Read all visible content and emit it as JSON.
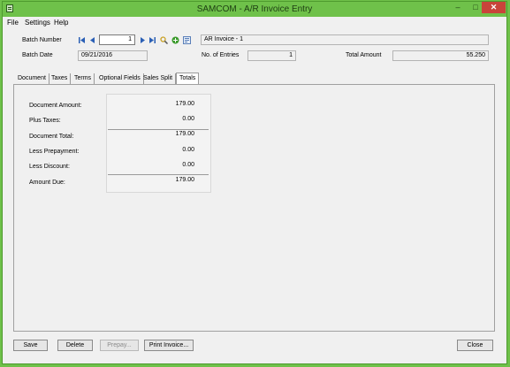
{
  "window": {
    "title": "SAMCOM - A/R Invoice Entry"
  },
  "window_controls": {
    "minimize": "–",
    "maximize": "□",
    "close": "✕"
  },
  "menu": [
    "File",
    "Settings",
    "Help"
  ],
  "header": {
    "batch_number_label": "Batch Number",
    "batch_number": "1",
    "batch_description": "AR Invoice - 1",
    "batch_date_label": "Batch Date",
    "batch_date": "09/21/2016",
    "entries_label": "No. of Entries",
    "entries": "1",
    "total_label": "Total Amount",
    "total": "55.250"
  },
  "icons": [
    "first-icon",
    "previous-icon",
    "next-icon",
    "last-icon",
    "search-icon",
    "new-icon",
    "settings-icon"
  ],
  "tabs": [
    "Document",
    "Taxes",
    "Terms",
    "Optional Fields",
    "Sales Split",
    "Totals"
  ],
  "active_tab": "Totals",
  "totals": [
    {
      "label": "Document Amount:",
      "value": "179.00"
    },
    {
      "label": "Plus Taxes:",
      "value": "0.00"
    },
    {
      "label": "Document Total:",
      "value": "179.00"
    },
    {
      "label": "Less Prepayment:",
      "value": "0.00"
    },
    {
      "label": "Less Discount:",
      "value": "0.00"
    },
    {
      "label": "Amount Due:",
      "value": "179.00"
    }
  ],
  "buttons": {
    "save": "Save",
    "delete": "Delete",
    "prepay": "Prepay...",
    "print": "Print Invoice...",
    "close": "Close"
  },
  "colors": {
    "title_bar": "#6fc14a",
    "close_button": "#c9443a",
    "panel": "#f0f0f0"
  }
}
